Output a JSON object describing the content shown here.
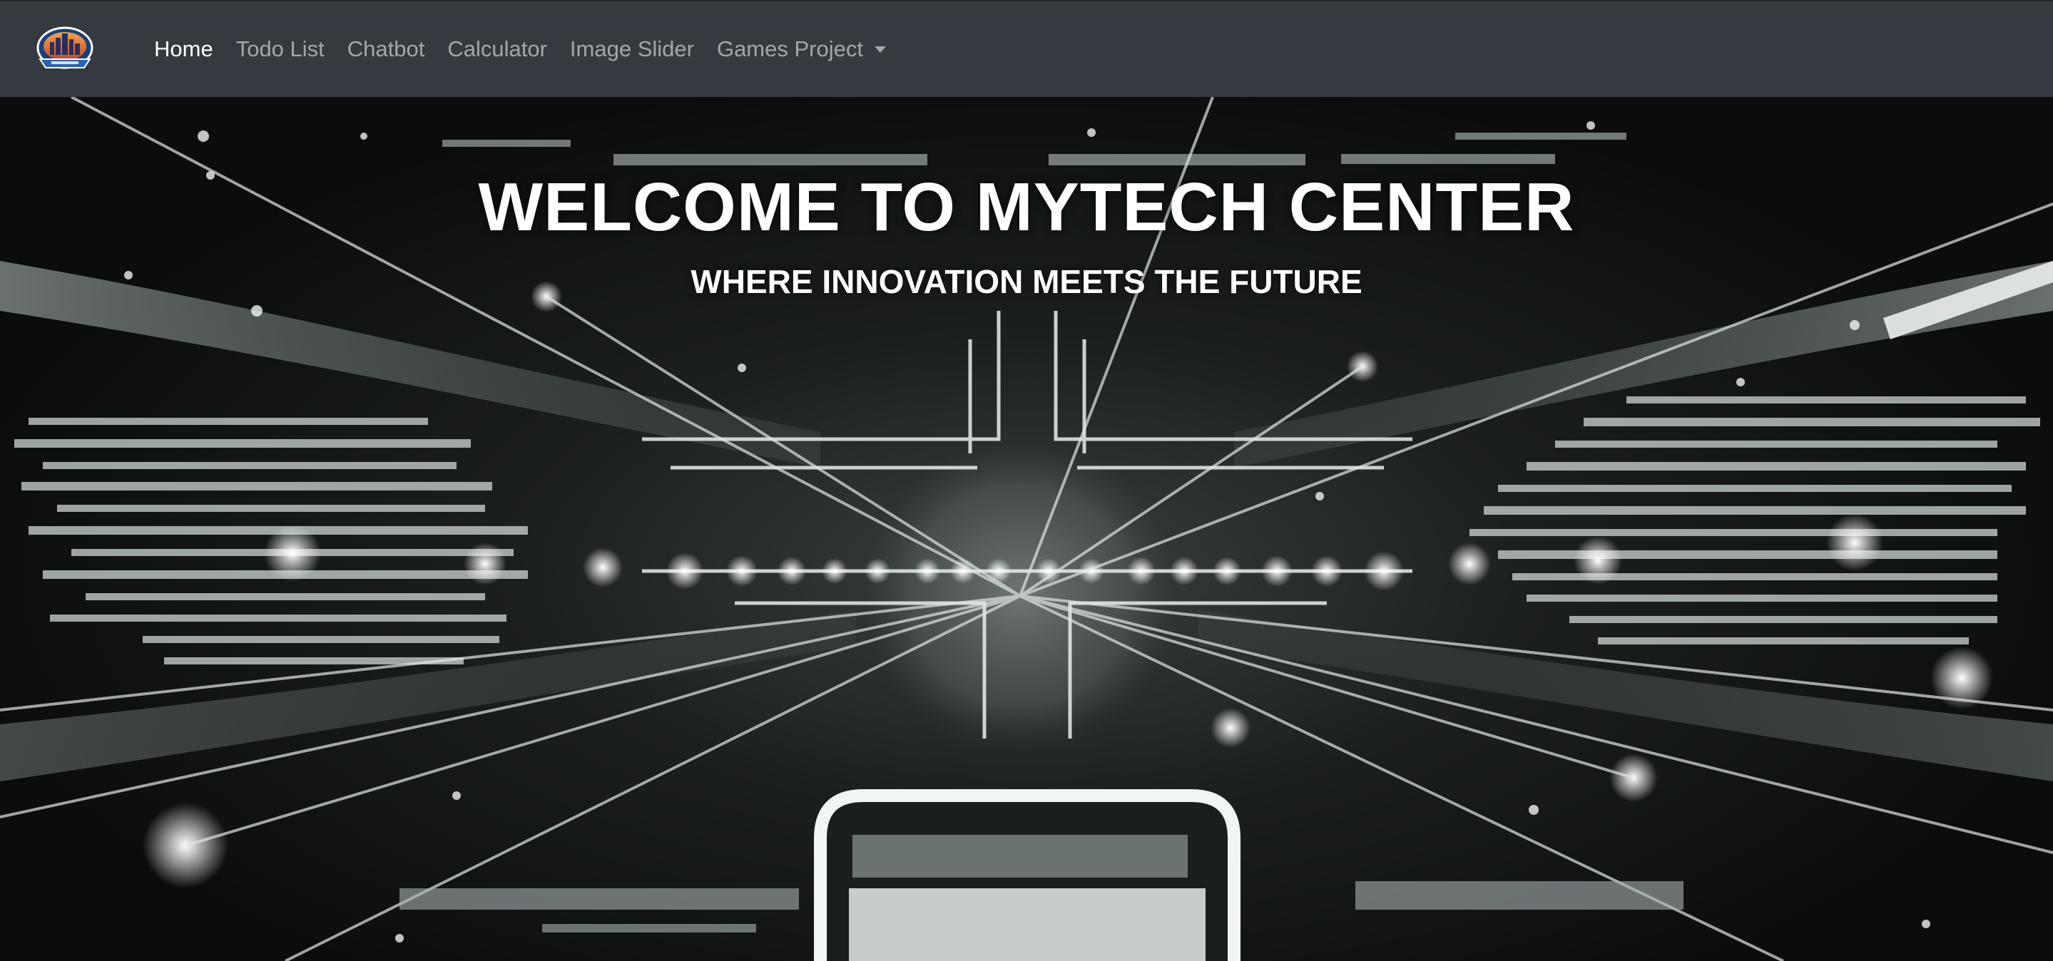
{
  "navbar": {
    "brand_icon": "city-badge-logo",
    "links": [
      {
        "label": "Home",
        "active": true
      },
      {
        "label": "Todo List",
        "active": false
      },
      {
        "label": "Chatbot",
        "active": false
      },
      {
        "label": "Calculator",
        "active": false
      },
      {
        "label": "Image Slider",
        "active": false
      },
      {
        "label": "Games Project",
        "active": false,
        "dropdown": true
      }
    ]
  },
  "hero": {
    "title": "WELCOME TO MYTECH CENTER",
    "subtitle": "WHERE INNOVATION MEETS THE FUTURE",
    "background_image": "futuristic-circuit-network-image"
  },
  "colors": {
    "navbar_bg": "#343a40",
    "nav_active": "#ffffff",
    "nav_inactive": "#8f9296",
    "hero_text": "#ffffff"
  }
}
